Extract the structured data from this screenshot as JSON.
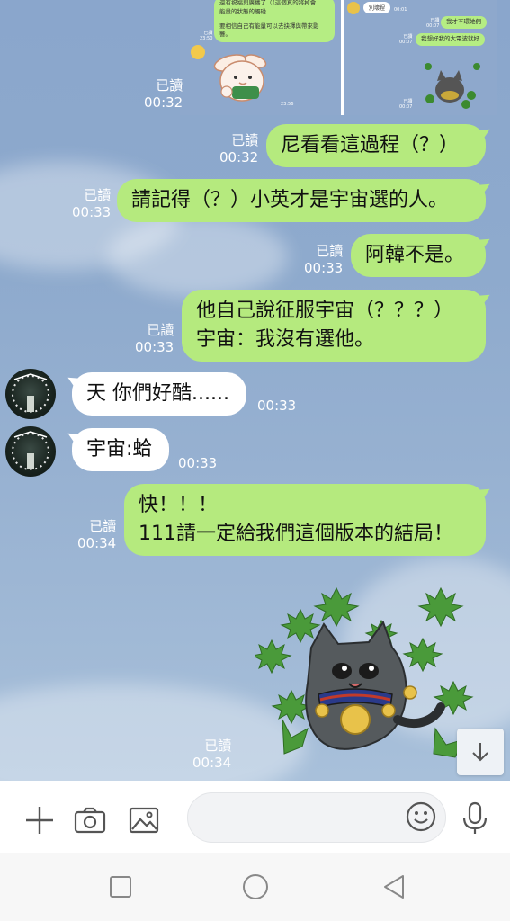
{
  "shot": {
    "left_bubble_lines": [
      "還有祝福與廣播了（（這個真的將掉會",
      "能量的狀態的觸碰",
      "",
      "要相信自己有能量可以去抉擇與帶來影",
      "響。"
    ],
    "left_time": "已讀\n23:50",
    "left_time2": "23:56",
    "right_white": "別壞捏",
    "right_white_time": "00:01",
    "right_green_1": "我才不環她們",
    "right_green_1_time": "已讀\n00:07",
    "right_green_2": "我想好我的大電波就好",
    "right_green_2_time": "已讀\n00:07",
    "right_bottom_time": "已讀\n00:07"
  },
  "messages": [
    {
      "side": "right",
      "read": "已讀",
      "time": "00:32",
      "text": ""
    },
    {
      "side": "right",
      "read": "已讀",
      "time": "00:32",
      "text": "尼看看這過程（？）"
    },
    {
      "side": "right",
      "read": "已讀",
      "time": "00:33",
      "text": "請記得（？）小英才是宇宙選的人。"
    },
    {
      "side": "right",
      "read": "已讀",
      "time": "00:33",
      "text": "阿韓不是。"
    },
    {
      "side": "right",
      "read": "已讀",
      "time": "00:33",
      "text": "他自己說征服宇宙（？？？）\n宇宙：我沒有選他。"
    },
    {
      "side": "left",
      "time": "00:33",
      "text": "天 你們好酷......"
    },
    {
      "side": "left",
      "time": "00:33",
      "text": "宇宙:蛤"
    },
    {
      "side": "right",
      "read": "已讀",
      "time": "00:34",
      "text": "快！！！\n111請一定給我們這個版本的結局！"
    },
    {
      "side": "right",
      "read": "已讀",
      "time": "00:34",
      "text": ""
    }
  ],
  "input": {
    "placeholder": ""
  },
  "colors": {
    "green_bubble": "#b5ea7e",
    "white_bubble": "#ffffff",
    "chat_bg": "#8aa6c9"
  },
  "icons": [
    "plus-icon",
    "camera-icon",
    "image-icon",
    "emoji-icon",
    "mic-icon",
    "arrow-down-icon",
    "nav-recents-icon",
    "nav-home-icon",
    "nav-back-icon"
  ]
}
